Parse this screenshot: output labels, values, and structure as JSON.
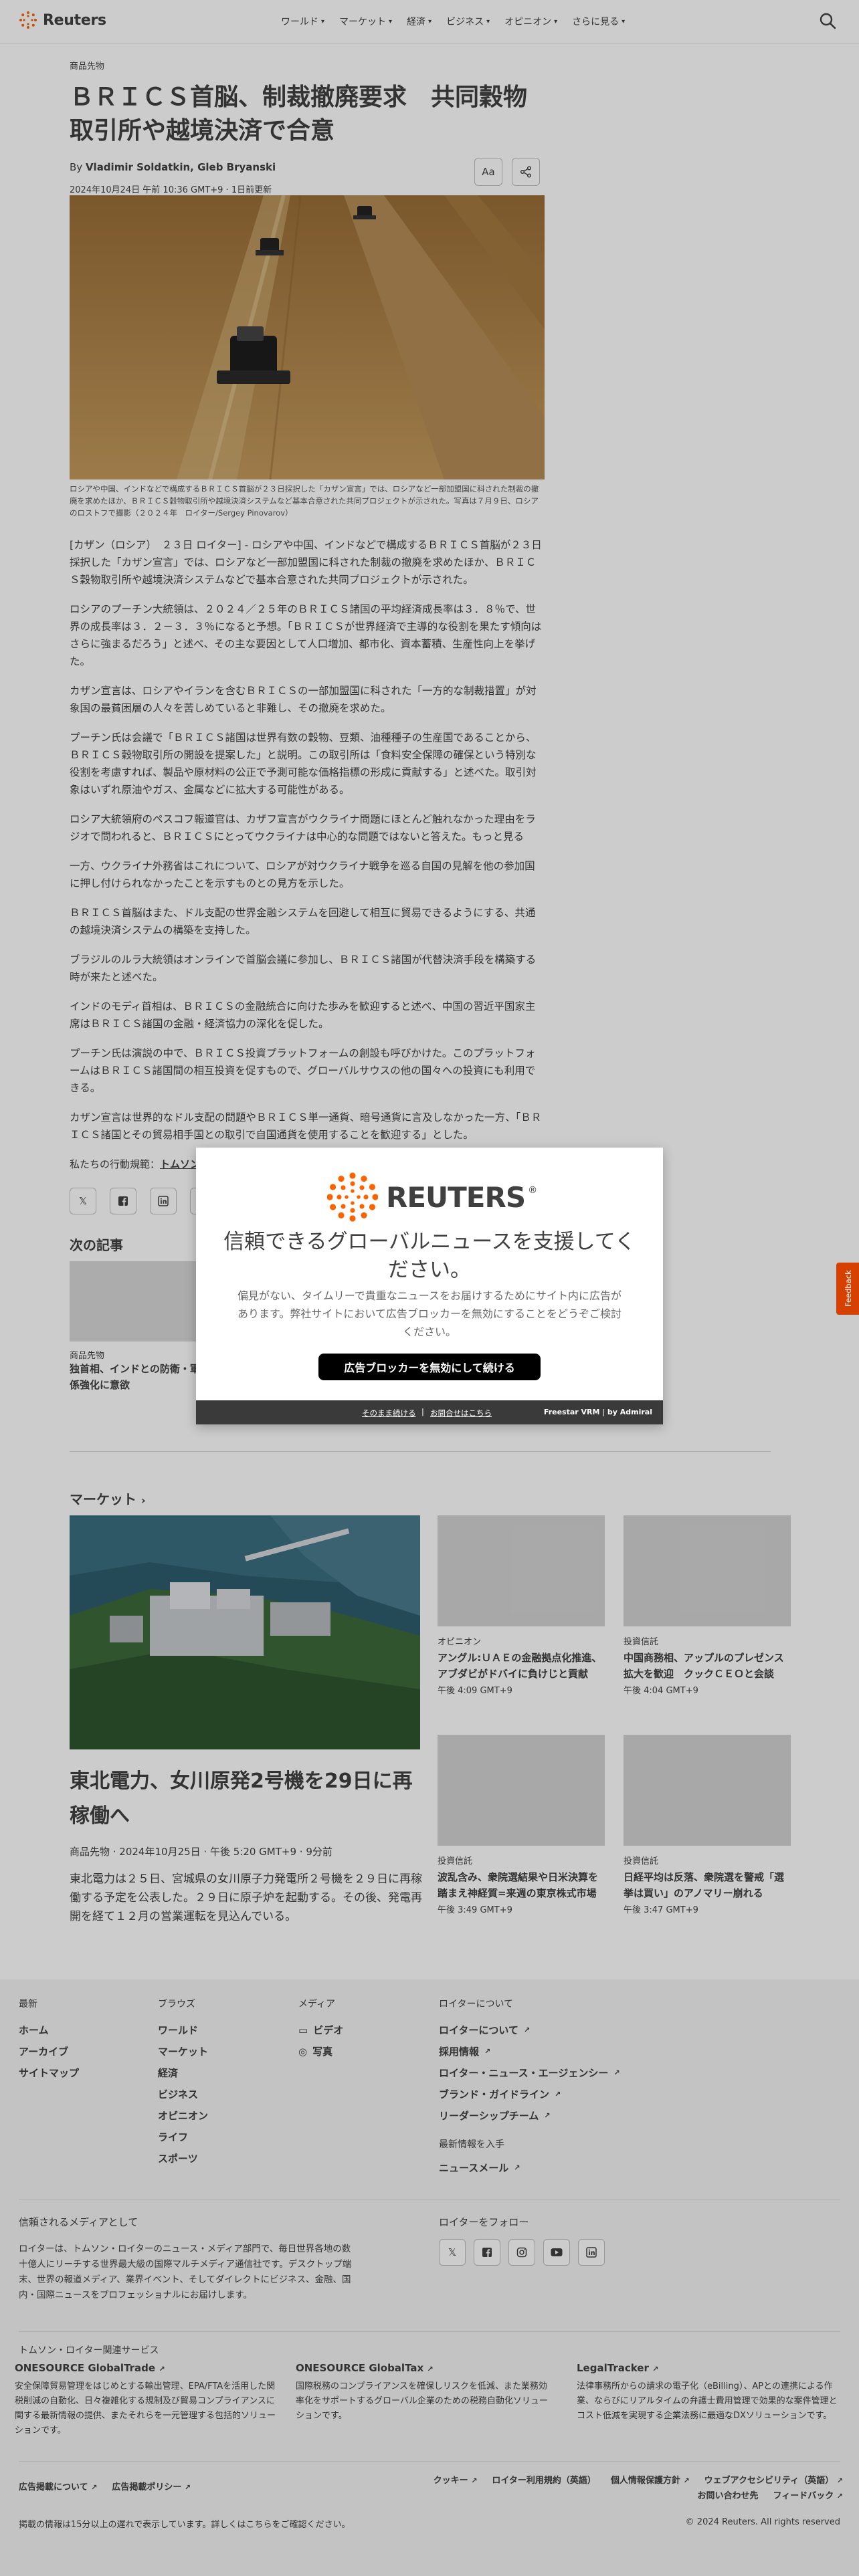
{
  "brand": {
    "name": "Reuters",
    "accent": "#fa6400"
  },
  "nav": {
    "items": [
      {
        "label": "ワールド"
      },
      {
        "label": "マーケット"
      },
      {
        "label": "経済"
      },
      {
        "label": "ビジネス"
      },
      {
        "label": "オピニオン"
      },
      {
        "label": "さらに見る"
      }
    ]
  },
  "article": {
    "section": "商品先物",
    "headline": "ＢＲＩＣＳ首脳、制裁撤廃要求　共同穀物取引所や越境決済で合意",
    "by_prefix": "By ",
    "authors": "Vladimir Soldatkin, Gleb Bryanski",
    "dateline": "2024年10月24日 午前 10:36 GMT+9 · 1日前更新",
    "font_size_btn": "Aa",
    "caption": "ロシアや中国、インドなどで構成するＢＲＩＣＳ首脳が２３日採択した「カザン宣言」では、ロシアなど一部加盟国に科された制裁の撤廃を求めたほか、ＢＲＩＣＳ穀物取引所や越境決済システムなど基本合意された共同プロジェクトが示された。写真は７月９日、ロシアのロストフで撮影（２０２４年　ロイター/Sergey Pinovarov）",
    "paragraphs": [
      "[カザン（ロシア）　２３日 ロイター] - ロシアや中国、インドなどで構成するＢＲＩＣＳ首脳が２３日採択した「カザン宣言」では、ロシアなど一部加盟国に科された制裁の撤廃を求めたほか、ＢＲＩＣＳ穀物取引所や越境決済システムなどで基本合意された共同プロジェクトが示された。",
      "ロシアのプーチン大統領は、２０２４／２５年のＢＲＩＣＳ諸国の平均経済成長率は３．８％で、世界の成長率は３．２－３．３％になると予想。「ＢＲＩＣＳが世界経済で主導的な役割を果たす傾向はさらに強まるだろう」と述べ、その主な要因として人口増加、都市化、資本蓄積、生産性向上を挙げた。",
      "カザン宣言は、ロシアやイランを含むＢＲＩＣＳの一部加盟国に科された「一方的な制裁措置」が対象国の最貧困層の人々を苦しめていると非難し、その撤廃を求めた。",
      "プーチン氏は会議で「ＢＲＩＣＳ諸国は世界有数の穀物、豆類、油種種子の生産国であることから、ＢＲＩＣＳ穀物取引所の開設を提案した」と説明。この取引所は「食料安全保障の確保という特別な役割を考慮すれば、製品や原材料の公正で予測可能な価格指標の形成に貢献する」と述べた。取引対象はいずれ原油やガス、金属などに拡大する可能性がある。",
      "ロシア大統領府のペスコフ報道官は、カザフ宣言がウクライナ問題にほとんど触れなかった理由をラジオで問われると、ＢＲＩＣＳにとってウクライナは中心的な問題ではないと答えた。もっと見る",
      "一方、ウクライナ外務省はこれについて、ロシアが対ウクライナ戦争を巡る自国の見解を他の参加国に押し付けられなかったことを示すものとの見方を示した。",
      "ＢＲＩＣＳ首脳はまた、ドル支配の世界金融システムを回避して相互に貿易できるようにする、共通の越境決済システムの構築を支持した。",
      "ブラジルのルラ大統領はオンラインで首脳会議に参加し、ＢＲＩＣＳ諸国が代替決済手段を構築する時が来たと述べた。",
      "インドのモディ首相は、ＢＲＩＣＳの金融統合に向けた歩みを歓迎すると述べ、中国の習近平国家主席はＢＲＩＣＳ諸国の金融・経済協力の深化を促した。",
      "プーチン氏は演説の中で、ＢＲＩＣＳ投資プラットフォームの創設も呼びかけた。このプラットフォームはＢＲＩＣＳ諸国間の相互投資を促すもので、グローバルサウスの他の国々への投資にも利用できる。",
      "カザン宣言は世界的なドル支配の問題やＢＲＩＣＳ単一通貨、暗号通貨に言及しなかった一方、「ＢＲＩＣＳ諸国とその貿易相手国との取引で自国通貨を使用することを歓迎する」とした。"
    ],
    "conduct_prefix": "私たちの行動規範：",
    "conduct_link": "トムソン・ロイター「信頼の原則」"
  },
  "next": {
    "title": "次の記事",
    "card": {
      "kicker": "商品先物",
      "headline": "独首相、インドとの防衛・軍事関係強化に意欲"
    }
  },
  "markets": {
    "title": "マーケット",
    "main": {
      "headline": "東北電力、女川原発2号機を29日に再稼働へ",
      "meta": "商品先物 · 2024年10月25日 · 午後 5:20 GMT+9 · 9分前",
      "desc": "東北電力は２５日、宮城県の女川原子力発電所２号機を２９日に再稼働する予定を公表した。２９日に原子炉を起動する。その後、発電再開を経て１２月の営業運転を見込んでいる。"
    },
    "cards": [
      {
        "kicker": "オピニオン",
        "headline": "アングル:ＵＡＥの金融拠点化推進、アブダビがドバイに負けじと貢献",
        "time": "午後 4:09 GMT+9"
      },
      {
        "kicker": "投資信託",
        "headline": "中国商務相、アップルのプレゼンス拡大を歓迎　クックＣＥＯと会談",
        "time": "午後 4:04 GMT+9"
      },
      {
        "kicker": "投資信託",
        "headline": "波乱含み、衆院選結果や日米決算を踏まえ神経質=来週の東京株式市場",
        "time": "午後 3:49 GMT+9"
      },
      {
        "kicker": "投資信託",
        "headline": "日経平均は反落、衆院選を警戒「選挙は買い」のアノマリー崩れる",
        "time": "午後 3:47 GMT+9"
      }
    ]
  },
  "footer": {
    "cols": [
      {
        "head": "最新",
        "links": [
          "ホーム",
          "アーカイブ",
          "サイトマップ"
        ]
      },
      {
        "head": "ブラウズ",
        "links": [
          "ワールド",
          "マーケット",
          "経済",
          "ビジネス",
          "オピニオン",
          "ライフ",
          "スポーツ"
        ]
      },
      {
        "head": "メディア",
        "links": [
          "ビデオ",
          "写真"
        ]
      },
      {
        "head": "ロイターについて",
        "links": [
          "ロイターについて",
          "採用情報",
          "ロイター・ニュース・エージェンシー",
          "ブランド・ガイドライン",
          "リーダーシップチーム"
        ]
      }
    ],
    "latest_head": "最新情報を入手",
    "newsletter": "ニュースメール",
    "trusted_title": "信頼されるメディアとして",
    "trusted_text": "ロイターは、トムソン・ロイターのニュース・メディア部門で、毎日世界各地の数十億人にリーチする世界最大級の国際マルチメディア通信社です。デスクトップ端末、世界の報道メディア、業界イベント、そしてダイレクトにビジネス、金融、国内・国際ニュースをプロフェッショナルにお届けします。",
    "follow_title": "ロイターをフォロー",
    "services_title": "トムソン・ロイター関連サービス",
    "services": [
      {
        "name": "ONESOURCE GlobalTrade",
        "desc": "安全保障貿易管理をはじめとする輸出管理、EPA/FTAを活用した関税削減の自動化、日々複雑化する規制及び貿易コンプライアンスに関する最新情報の提供、またそれらを一元管理する包括的ソリューションです。"
      },
      {
        "name": "ONESOURCE GlobalTax",
        "desc": "国際税務のコンプライアンスを確保しリスクを低減、また業務効率化をサポートするグローバル企業のための税務自動化ソリューションです。"
      },
      {
        "name": "LegalTracker",
        "desc": "法律事務所からの請求の電子化（eBilling）、APとの連携による作業、ならびにリアルタイムの弁護士費用管理で効果的な案件管理とコスト低減を実現する企業法務に最適なDXソリューションです。"
      }
    ],
    "legal_left": [
      "広告掲載について",
      "広告掲載ポリシー"
    ],
    "legal_right": [
      "クッキー",
      "ロイター利用規約（英語）",
      "個人情報保護方針",
      "ウェブアクセシビリティ（英語）",
      "お問い合わせ先",
      "フィードバック"
    ],
    "note": "掲載の情報は15分以上の遅れで表示しています。詳しくはこちらをご確認ください。",
    "copyright": "© 2024 Reuters. All rights reserved"
  },
  "modal": {
    "logo": "REUTERS",
    "title": "信頼できるグローバルニュースを支援してください。",
    "text": "偏見がない、タイムリーで貴重なニュースをお届けするためにサイト内に広告があります。弊社サイトにおいて広告ブロッカーを無効にすることをどうぞご検討ください。",
    "button": "広告ブロッカーを無効にして続ける",
    "link_continue": "そのまま続ける",
    "link_howto": "お問合せはこちら",
    "powered": "Freestar VRM",
    "by": "by Admiral"
  },
  "feedback": "Feedback"
}
